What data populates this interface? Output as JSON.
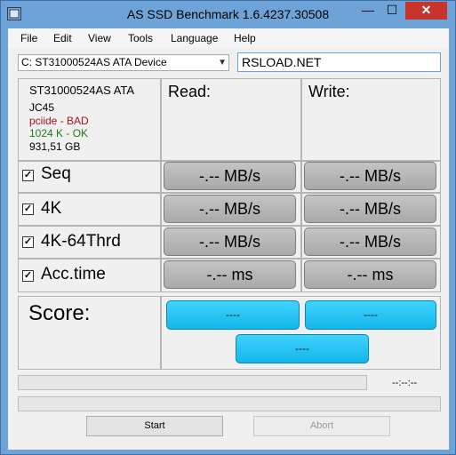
{
  "window": {
    "title": "AS SSD Benchmark 1.6.4237.30508",
    "minimize": "—",
    "maximize": "☐",
    "close": "✕"
  },
  "menu": [
    "File",
    "Edit",
    "View",
    "Tools",
    "Language",
    "Help"
  ],
  "device_select": {
    "value": "C: ST31000524AS ATA Device"
  },
  "text_field": {
    "value": "RSLOAD.NET"
  },
  "info": {
    "model": "ST31000524AS ATA",
    "firmware": "JC45",
    "driver": "pciide - BAD",
    "alignment": "1024 K - OK",
    "size": "931,51 GB"
  },
  "columns": {
    "read": "Read:",
    "write": "Write:"
  },
  "rows": [
    {
      "label": "Seq",
      "read": "-.-- MB/s",
      "write": "-.-- MB/s"
    },
    {
      "label": "4K",
      "read": "-.-- MB/s",
      "write": "-.-- MB/s"
    },
    {
      "label": "4K-64Thrd",
      "read": "-.-- MB/s",
      "write": "-.-- MB/s"
    },
    {
      "label": "Acc.time",
      "read": "-.-- ms",
      "write": "-.-- ms"
    }
  ],
  "score": {
    "label": "Score:",
    "read": "----",
    "write": "----",
    "total": "----"
  },
  "time_text": "--:--:--",
  "buttons": {
    "start": "Start",
    "abort": "Abort"
  },
  "colors": {
    "bad": "#a31515",
    "ok": "#1e7a1e",
    "accent": "#1fc3f5"
  }
}
